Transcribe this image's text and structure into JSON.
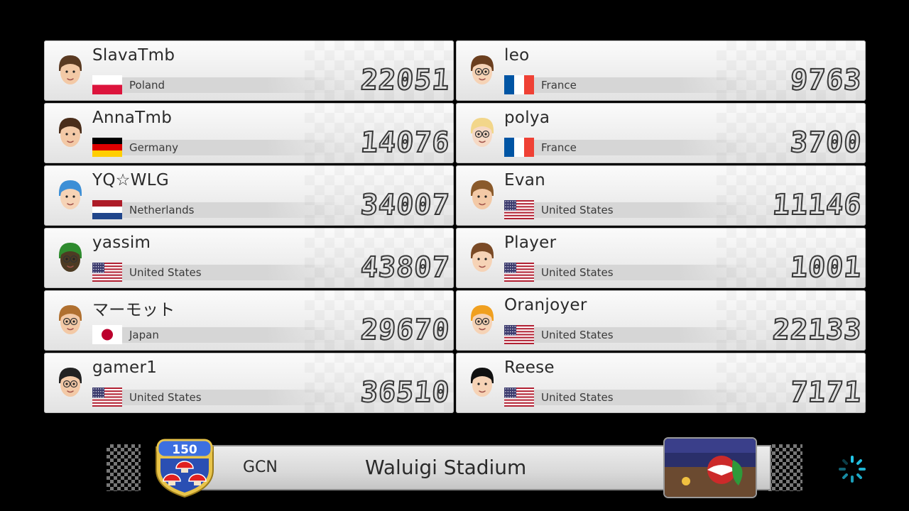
{
  "players": [
    {
      "name": "SlavaTmb",
      "country": "Poland",
      "flag": "poland",
      "score": "22051",
      "avatar": {
        "hair": "#5a3a22",
        "skin": "#f3c9a6",
        "glasses": false
      }
    },
    {
      "name": "leo",
      "country": "France",
      "flag": "france",
      "score": "9763",
      "avatar": {
        "hair": "#6b3f1f",
        "skin": "#f6d3b6",
        "glasses": true
      }
    },
    {
      "name": "AnnaTmb",
      "country": "Germany",
      "flag": "germany",
      "score": "14076",
      "avatar": {
        "hair": "#4a2d1a",
        "skin": "#f3c9a6",
        "glasses": false
      }
    },
    {
      "name": "polya",
      "country": "France",
      "flag": "france",
      "score": "3700",
      "avatar": {
        "hair": "#f2d68a",
        "skin": "#f6d9c4",
        "glasses": true
      }
    },
    {
      "name": "YQ☆WLG",
      "country": "Netherlands",
      "flag": "netherlands",
      "score": "34007",
      "avatar": {
        "hair": "#3d8fd6",
        "skin": "#f6d3b6",
        "glasses": false
      }
    },
    {
      "name": "Evan",
      "country": "United States",
      "flag": "usa",
      "score": "11146",
      "avatar": {
        "hair": "#8a5a2b",
        "skin": "#f3c9a6",
        "glasses": false
      }
    },
    {
      "name": "yassim",
      "country": "United States",
      "flag": "usa",
      "score": "43807",
      "avatar": {
        "hair": "#2e8b2e",
        "skin": "#4d3b23",
        "glasses": true
      }
    },
    {
      "name": "Player",
      "country": "United States",
      "flag": "usa",
      "score": "1001",
      "avatar": {
        "hair": "#7a4a26",
        "skin": "#f6d3b6",
        "glasses": false
      }
    },
    {
      "name": "マーモット",
      "country": "Japan",
      "flag": "japan",
      "score": "29670",
      "avatar": {
        "hair": "#b07030",
        "skin": "#f3c9a6",
        "glasses": true
      }
    },
    {
      "name": "Oranjoyer",
      "country": "United States",
      "flag": "usa",
      "score": "22133",
      "avatar": {
        "hair": "#f0a020",
        "skin": "#f6d3b6",
        "glasses": true
      }
    },
    {
      "name": "gamer1",
      "country": "United States",
      "flag": "usa",
      "score": "36510",
      "avatar": {
        "hair": "#222222",
        "skin": "#f3c9a6",
        "glasses": true
      }
    },
    {
      "name": "Reese",
      "country": "United States",
      "flag": "usa",
      "score": "7171",
      "avatar": {
        "hair": "#111111",
        "skin": "#f6d3b6",
        "glasses": false
      }
    }
  ],
  "footer": {
    "engine_class": "150",
    "cup": "GCN",
    "track": "Waluigi Stadium"
  },
  "icons": {
    "emblem": "mushroom-cup-emblem-icon",
    "thumbnail": "track-preview-thumbnail",
    "loading": "loading-spinner-icon"
  }
}
